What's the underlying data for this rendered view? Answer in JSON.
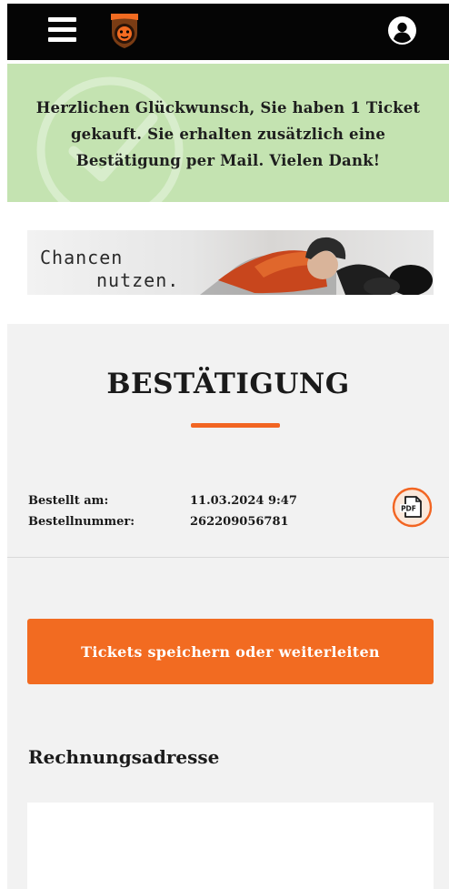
{
  "header": {
    "menu_icon": "hamburger-menu-icon",
    "logo_icon": "grizzlys-logo",
    "account_icon": "user-account-icon",
    "colors": {
      "background": "#050505",
      "icon": "#ffffff"
    }
  },
  "success_banner": {
    "message": "Herzlichen Glückwunsch, Sie haben 1 Ticket gekauft. Sie erhalten zusätzlich eine Bestätigung per Mail. Vielen Dank!",
    "icon": "checkmark-circle-watermark-icon",
    "background": "#c4e3b1"
  },
  "ad_banner": {
    "line1": "Chancen",
    "line2": "nutzen."
  },
  "confirmation": {
    "title": "BESTÄTIGUNG",
    "ordered_label": "Bestellt am:",
    "ordered_value": "11.03.2024 9:47",
    "order_number_label": "Bestellnummer:",
    "order_number_value": "262209056781",
    "pdf_label": "PDF",
    "accent": "#f26522"
  },
  "actions": {
    "save_forward_label": "Tickets speichern oder weiterleiten"
  },
  "billing": {
    "heading": "Rechnungsadresse"
  }
}
